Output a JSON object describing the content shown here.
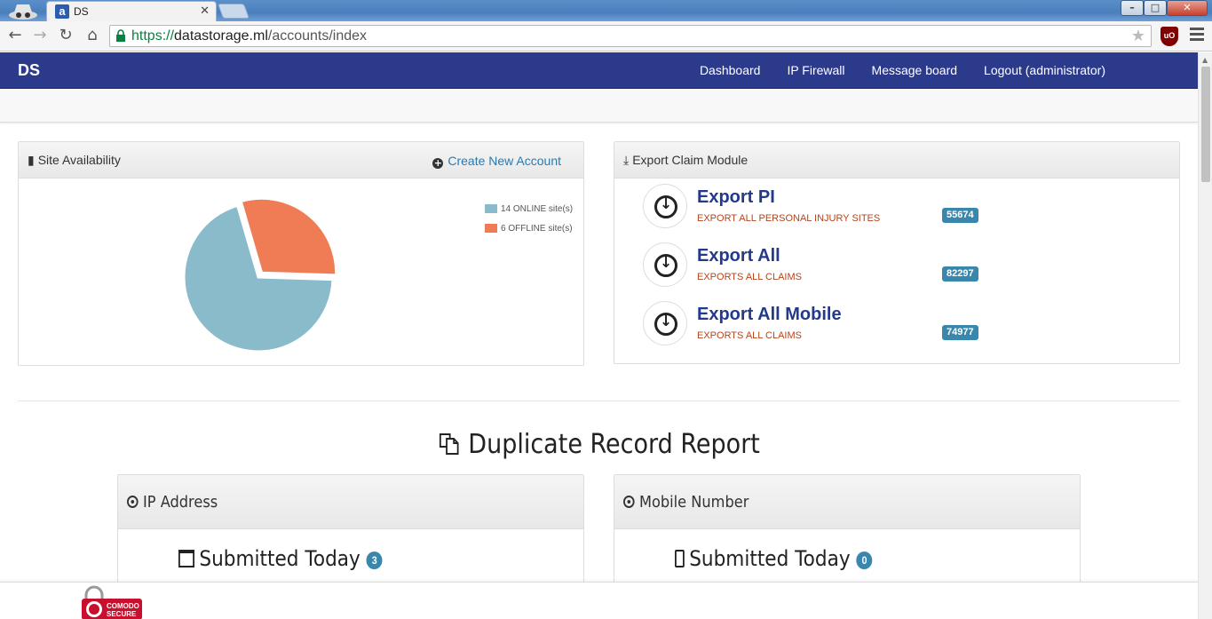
{
  "browser": {
    "tab_title": "DS",
    "tab_favicon_letter": "a",
    "url_scheme": "https://",
    "url_host": "datastorage.ml",
    "url_path": "/accounts/index",
    "extension_label": "uO"
  },
  "navbar": {
    "brand": "DS",
    "links": [
      "Dashboard",
      "IP Firewall",
      "Message board",
      "Logout (administrator)"
    ]
  },
  "site_panel": {
    "title": "Site Availability",
    "create_link": "Create New Account",
    "chart_data": {
      "type": "pie",
      "labels": [
        "ONLINE",
        "OFFLINE"
      ],
      "values": [
        14,
        6
      ],
      "legend": [
        "14 ONLINE site(s)",
        "6 OFFLINE site(s)"
      ],
      "colors": [
        "#89bbca",
        "#f07c56"
      ],
      "legend_position": "top-right"
    }
  },
  "export_panel": {
    "title": "Export Claim Module",
    "items": [
      {
        "name": "Export PI",
        "desc": "EXPORT ALL PERSONAL INJURY SITES",
        "count": "55674"
      },
      {
        "name": "Export All",
        "desc": "EXPORTS ALL CLAIMS",
        "count": "82297"
      },
      {
        "name": "Export All Mobile",
        "desc": "EXPORTS ALL CLAIMS",
        "count": "74977"
      }
    ]
  },
  "duplicate_report": {
    "title": "Duplicate Record Report",
    "ip_panel": {
      "title": "IP Address",
      "submitted_label": "Submitted Today",
      "submitted_count": "3"
    },
    "mobile_panel": {
      "title": "Mobile Number",
      "submitted_label": "Submitted Today",
      "submitted_count": "0"
    }
  },
  "footer": {
    "seal_text": [
      "COMODO",
      "SECURE"
    ]
  },
  "colors": {
    "navbar": "#2c3a8c",
    "link": "#2a7ab0",
    "export_title": "#233a8a",
    "export_desc": "#b4441b",
    "badge": "#3a87ad"
  }
}
